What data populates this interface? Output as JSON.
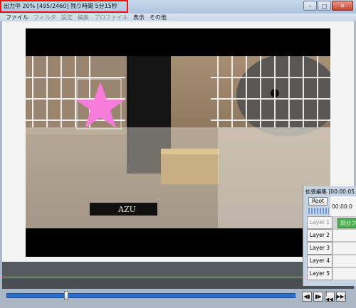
{
  "window": {
    "title": "出力中 20% [495/2460]  残り時間  5分15秒",
    "buttons": {
      "minimize": "–",
      "maximize": "□",
      "close": "✕"
    }
  },
  "menubar": {
    "items": [
      {
        "label": "ファイル",
        "enabled": true
      },
      {
        "label": "フィルタ",
        "enabled": false
      },
      {
        "label": "設定",
        "enabled": false
      },
      {
        "label": "編集",
        "enabled": false
      },
      {
        "label": "プロファイル",
        "enabled": false
      },
      {
        "label": "表示",
        "enabled": true
      },
      {
        "label": "その他",
        "enabled": true
      }
    ]
  },
  "preview": {
    "overlay_shape": "pink-star",
    "logo_text": "AZU",
    "star_color": "#f77bd8"
  },
  "slider": {
    "position": 0.2
  },
  "nav_buttons": [
    "◀▮",
    "▮▶",
    "|◀◀",
    "▶▶|"
  ],
  "ext_edit": {
    "title": "拡張編集 [00:00:05.",
    "root_label": "Root",
    "ruler_time": "00:00:0",
    "clip_label": "部分フ",
    "layers": [
      "Layer 1",
      "Layer 2",
      "Layer 3",
      "Layer 4",
      "Layer 5"
    ]
  },
  "colors": {
    "accent_red": "#e11111",
    "slider_blue": "#2e6fce",
    "timeline_green": "#35e07c"
  }
}
